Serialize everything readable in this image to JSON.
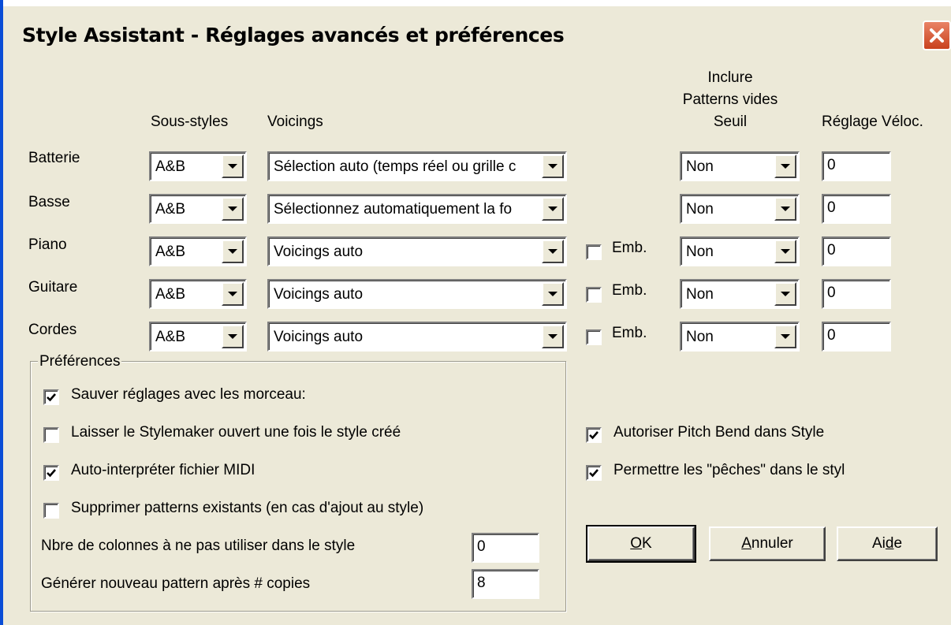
{
  "window": {
    "title": "Style Assistant - Réglages avancés et préférences"
  },
  "headers": {
    "substyles": "Sous-styles",
    "voicings": "Voicings",
    "include_line1": "Inclure",
    "include_line2": "Patterns vides",
    "include_line3": "Seuil",
    "velocity": "Réglage Véloc."
  },
  "rows": [
    {
      "label": "Batterie",
      "substyle": "A&B",
      "voicing": "Sélection auto (temps réel ou grille c",
      "emb_label": "",
      "threshold": "Non",
      "velocity": "0"
    },
    {
      "label": "Basse",
      "substyle": "A&B",
      "voicing": "Sélectionnez automatiquement la fo",
      "emb_label": "",
      "threshold": "Non",
      "velocity": "0"
    },
    {
      "label": "Piano",
      "substyle": "A&B",
      "voicing": "Voicings auto",
      "emb_label": "Emb.",
      "threshold": "Non",
      "velocity": "0"
    },
    {
      "label": "Guitare",
      "substyle": "A&B",
      "voicing": "Voicings auto",
      "emb_label": "Emb.",
      "threshold": "Non",
      "velocity": "0"
    },
    {
      "label": "Cordes",
      "substyle": "A&B",
      "voicing": "Voicings auto",
      "emb_label": "Emb.",
      "threshold": "Non",
      "velocity": "0"
    }
  ],
  "preferences": {
    "title": "Préférences",
    "save_settings": "Sauver réglages avec les morceau:",
    "keep_stylemaker_open": "Laisser le Stylemaker ouvert une fois le style créé",
    "auto_interpret_midi": "Auto-interpréter fichier MIDI",
    "delete_existing_patterns": "Supprimer patterns existants (en cas d'ajout au style)",
    "columns_label": "Nbre de colonnes à ne pas utiliser dans le style",
    "columns_value": "0",
    "copies_label": "Générer nouveau pattern après # copies",
    "copies_value": "8",
    "checked": {
      "save_settings": true,
      "keep_stylemaker_open": false,
      "auto_interpret_midi": true,
      "delete_existing_patterns": false
    }
  },
  "options": {
    "pitch_bend": "Autoriser Pitch Bend dans Style",
    "pushes": "Permettre les \"pêches\" dans le styl",
    "checked": {
      "pitch_bend": true,
      "pushes": true
    }
  },
  "buttons": {
    "ok_mn": "O",
    "ok_rest": "K",
    "cancel_mn": "A",
    "cancel_rest": "nnuler",
    "help_pre": "Ai",
    "help_mn": "d",
    "help_post": "e"
  },
  "icons": {
    "close": "close-icon",
    "dropdown": "chevron-down-icon",
    "check": "checkmark-icon"
  },
  "colors": {
    "frame": "#0a4dd6",
    "face": "#ece9d8",
    "close": "#d9532e"
  }
}
